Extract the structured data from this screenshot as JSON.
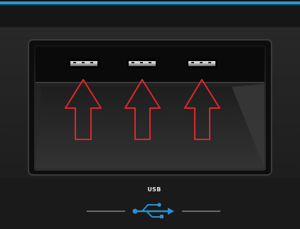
{
  "scene": {
    "panel_label": "USB",
    "colors": {
      "accent_strip": "#2a95c8",
      "arrow_outline": "#e0262b",
      "usb_logo": "#2a8fd0",
      "panel": "#1b1b1b"
    },
    "icons": [
      "usb-symbol-icon",
      "arrow-up-icon"
    ]
  }
}
